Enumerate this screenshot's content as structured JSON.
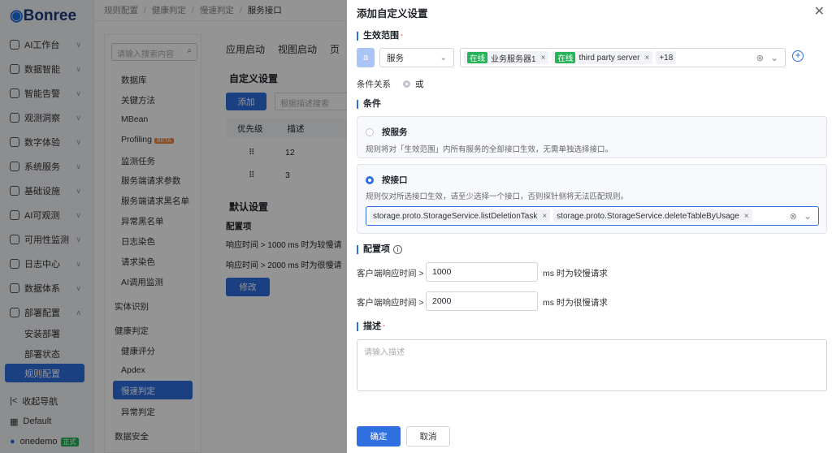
{
  "app": {
    "logo": "Bonree",
    "breadcrumb": [
      "规则配置",
      "健康判定",
      "慢速判定",
      "服务接口"
    ],
    "nav": {
      "items": [
        "AI工作台",
        "数据智能",
        "智能告警",
        "观测洞察",
        "数字体验",
        "系统服务",
        "基础设施",
        "AI可观测",
        "可用性监测",
        "日志中心",
        "数据体系",
        "部署配置"
      ],
      "sub": [
        "安装部署",
        "部署状态",
        "规则配置"
      ],
      "bottom": [
        "收起导航",
        "Default",
        "onedemo"
      ],
      "user_badge": "正式"
    },
    "mid": {
      "search_placeholder": "请输入搜索内容",
      "items": [
        "数据库",
        "关键方法",
        "MBean",
        "Profiling",
        "监测任务",
        "服务端请求参数",
        "服务端请求黑名单",
        "异常黑名单",
        "日志染色",
        "请求染色",
        "AI调用监测"
      ],
      "beta": "BETA",
      "groups": [
        "实体识别",
        "健康判定"
      ],
      "health_items": [
        "健康评分",
        "Apdex",
        "慢速判定",
        "异常判定"
      ],
      "last_group": "数据安全"
    },
    "content": {
      "tabs": [
        "应用启动",
        "视图启动",
        "页"
      ],
      "custom_title": "自定义设置",
      "add_button": "添加",
      "filter_placeholder": "根据描述搜索",
      "table_headers": [
        "优先级",
        "描述"
      ],
      "rows": [
        "12",
        "3"
      ],
      "default_title": "默认设置",
      "config_label": "配置项",
      "line1": "响应时间 > 1000 ms 时为较慢请",
      "line2": "响应时间 > 2000 ms 时为很慢请",
      "edit_button": "修改"
    }
  },
  "drawer": {
    "title": "添加自定义设置",
    "scope_label": "生效范围",
    "scope_type_badge": "a",
    "scope_type": "服务",
    "scope_tags": [
      {
        "status": "在线",
        "name": "业务服务器1"
      },
      {
        "status": "在线",
        "name": "third party server"
      }
    ],
    "scope_more": "+18",
    "cond_relation_label": "条件关系",
    "cond_relation_value": "或",
    "condition_label": "条件",
    "by_service": {
      "title": "按服务",
      "hint": "规则将对「生效范围」内所有服务的全部接口生效，无需单独选择接口。"
    },
    "by_interface": {
      "title": "按接口",
      "hint": "规则仅对所选接口生效，请至少选择一个接口，否则探针侧将无法匹配规则。",
      "tags": [
        "storage.proto.StorageService.listDeletionTask",
        "storage.proto.StorageService.deleteTableByUsage"
      ]
    },
    "config_label": "配置项",
    "slow": {
      "label": "客户端响应时间",
      "op": ">",
      "value": "1000",
      "suffix": "ms 时为较慢请求"
    },
    "very_slow": {
      "label": "客户端响应时间",
      "op": ">",
      "value": "2000",
      "suffix": "ms 时为很慢请求"
    },
    "desc_label": "描述",
    "desc_placeholder": "请输入描述",
    "confirm": "确定",
    "cancel": "取消"
  },
  "colors": {
    "primary": "#2f6fe0",
    "online": "#27b35a",
    "required": "#f56c6c"
  }
}
